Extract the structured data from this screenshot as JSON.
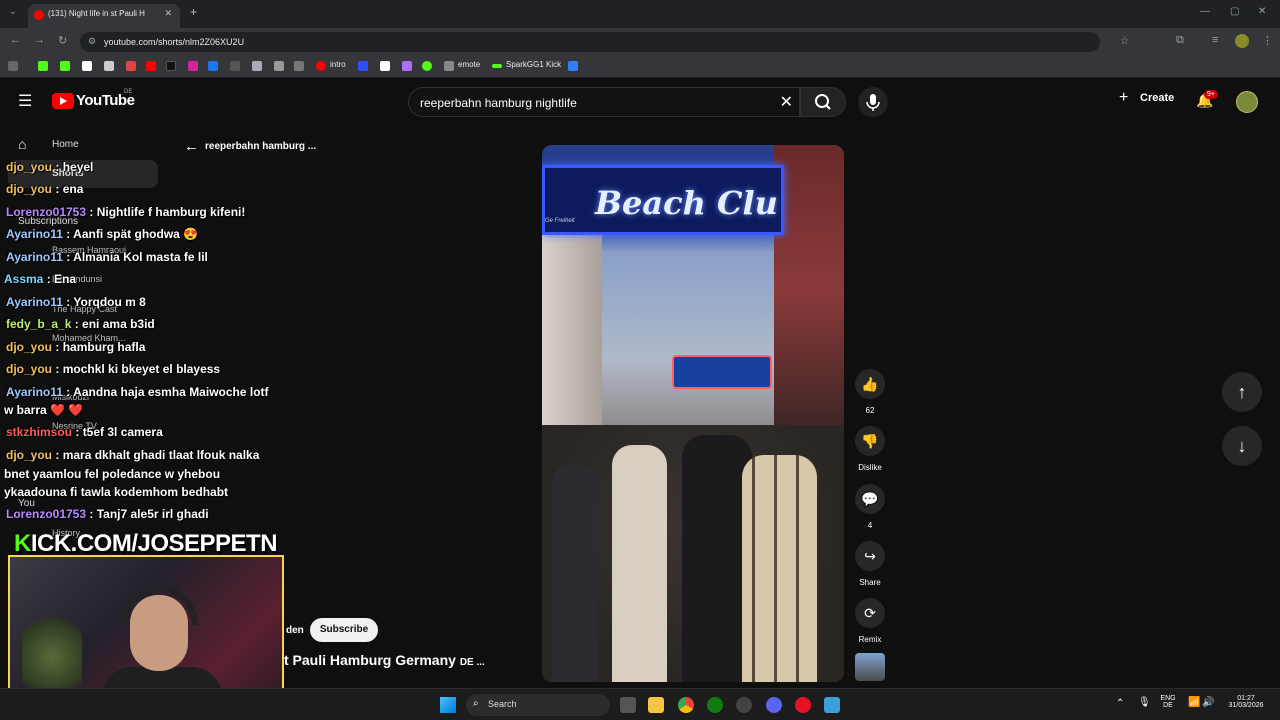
{
  "browser": {
    "tab_title": "(131) Night life in st Pauli H",
    "url": "youtube.com/shorts/nlm2Z06XU2U",
    "bookmarks": [
      "intro",
      "emote",
      "SparkGG1 Kick"
    ]
  },
  "youtube": {
    "logo_text": "YouTube",
    "region": "DE",
    "search_query": "reeperbahn hamburg nightlife",
    "create_label": "Create",
    "notif_badge": "9+",
    "back_label": "reeperbahn hamburg ...",
    "sidebar": {
      "home": "Home",
      "shorts": "Shorts",
      "subscriptions": "Subscriptions",
      "subs": [
        "Bassem Hamraoui",
        "Elferundunsi",
        "The Happy Cast",
        "Mohamed Kham...",
        "Kmocuti",
        "Misikouzi",
        "Nesrine TV",
        "Sh...",
        ""
      ],
      "you": "You",
      "history": "History"
    },
    "actions": {
      "likes": "62",
      "dislike": "Dislike",
      "comments": "4",
      "share": "Share",
      "remix": "Remix"
    },
    "channel_suffix": "den",
    "subscribe_label": "Subscribe",
    "video_title": "t Pauli Hamburg Germany",
    "video_title_flag": "DE ...",
    "video_sign": "Beach Clu",
    "video_freiheit": "Ge Freiheit"
  },
  "chat": [
    {
      "user": "djo_you",
      "msg": ": heyel"
    },
    {
      "user": "djo_you",
      "msg": ": ena"
    },
    {
      "user": "Lorenzo01753",
      "msg": ": Nightlife f hamburg kifeni!"
    },
    {
      "user": "Ayarino11",
      "msg": ": Aanfi spät ghodwa 😍"
    },
    {
      "user": "Ayarino11",
      "msg": ": Almania Kol masta fe lil"
    },
    {
      "user": "Assma",
      "msg": ": Ena"
    },
    {
      "user": "Ayarino11",
      "msg": ": Yorqdou m 8"
    },
    {
      "user": "fedy_b_a_k",
      "msg": ": eni ama b3id"
    },
    {
      "user": "djo_you",
      "msg": ": hamburg hafla"
    },
    {
      "user": "djo_you",
      "msg": ": mochkl ki bkeyet el blayess"
    },
    {
      "user": "Ayarino11",
      "msg": ": Aandna haja esmha Maiwoche lotf"
    },
    {
      "user": "",
      "msg": "w barra ❤️ ❤️"
    },
    {
      "user": "stkzhimsou",
      "msg": ": t5ef 3l camera"
    },
    {
      "user": "djo_you",
      "msg": ": mara dkhalt ghadi tlaat lfouk nalka"
    },
    {
      "user": "",
      "msg": "bnet yaamlou fel poledance w yhebou"
    },
    {
      "user": "",
      "msg": "ykaadouna fi tawla kodemhom bedhabt"
    },
    {
      "user": "Lorenzo01753",
      "msg": ": Tanj7 ale5r irl ghadi"
    }
  ],
  "overlay": {
    "kick_k": "K",
    "kick_rest": "ICK.COM/JOSEPPETN"
  },
  "taskbar": {
    "search": "Search",
    "lang": "ENG",
    "region": "DE",
    "time": "01:27",
    "date": "31/03/2026"
  }
}
